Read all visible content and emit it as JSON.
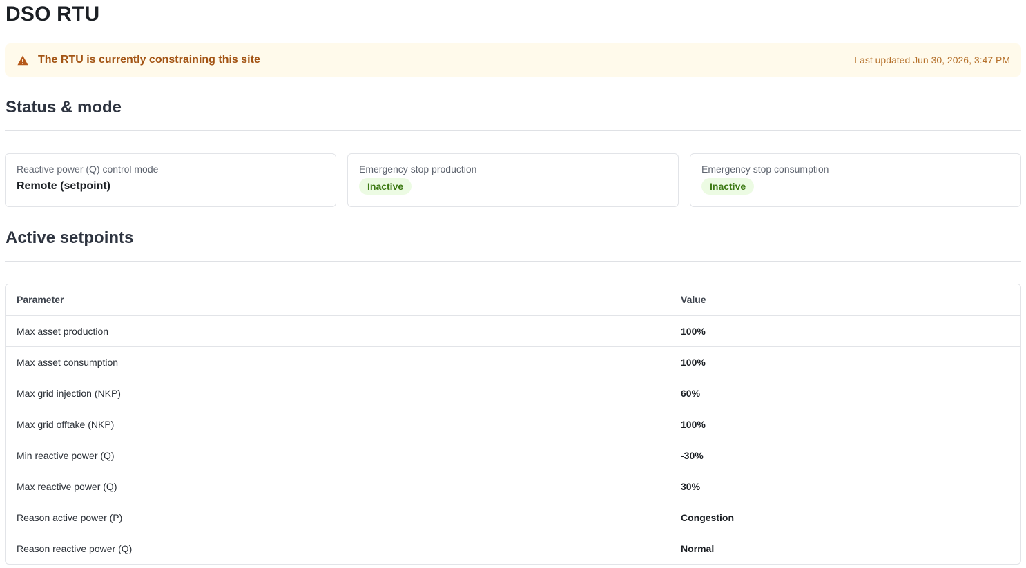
{
  "page": {
    "title": "DSO RTU"
  },
  "alert": {
    "icon": "warning-icon",
    "message": "The RTU is currently constraining this site",
    "last_updated": "Last updated Jun 30, 2026, 3:47 PM",
    "colors": {
      "background": "#fffaeb",
      "text": "#a35414"
    }
  },
  "status_section": {
    "title": "Status & mode",
    "cards": [
      {
        "label": "Reactive power (Q) control mode",
        "value": "Remote (setpoint)"
      },
      {
        "label": "Emergency stop production",
        "badge": "Inactive"
      },
      {
        "label": "Emergency stop consumption",
        "badge": "Inactive"
      }
    ],
    "badge_colors": {
      "background": "#ecfbe3",
      "text": "#3d7a14"
    }
  },
  "setpoints_section": {
    "title": "Active setpoints",
    "columns": [
      "Parameter",
      "Value"
    ],
    "rows": [
      {
        "parameter": "Max asset production",
        "value": "100%"
      },
      {
        "parameter": "Max asset consumption",
        "value": "100%"
      },
      {
        "parameter": "Max grid injection (NKP)",
        "value": "60%"
      },
      {
        "parameter": "Max grid offtake (NKP)",
        "value": "100%"
      },
      {
        "parameter": "Min reactive power (Q)",
        "value": "-30%"
      },
      {
        "parameter": "Max reactive power (Q)",
        "value": "30%"
      },
      {
        "parameter": "Reason active power (P)",
        "value": "Congestion"
      },
      {
        "parameter": "Reason reactive power (Q)",
        "value": "Normal"
      }
    ]
  }
}
